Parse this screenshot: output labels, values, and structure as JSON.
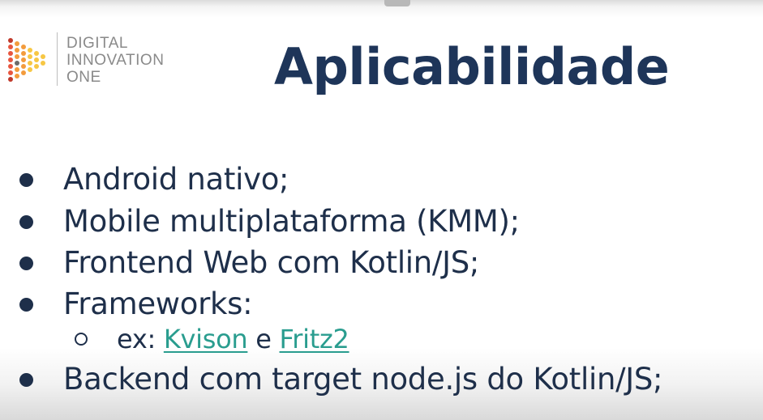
{
  "logo": {
    "line1": "DIGITAL",
    "line2": "INNOVATION",
    "line3": "ONE",
    "colors": [
      "#f7c744",
      "#f39c3d",
      "#e8563f",
      "#c0392b",
      "#6b6b6b"
    ]
  },
  "title": "Aplicabilidade",
  "bullets": [
    "Android nativo;",
    "Mobile multiplataforma (KMM);",
    "Frontend Web com Kotlin/JS;",
    "Frameworks:",
    "Backend com target node.js do Kotlin/JS;"
  ],
  "sub_bullet": {
    "prefix": "ex:",
    "link1": "Kvison",
    "conjunction": "e",
    "link2": "Fritz2"
  },
  "colors": {
    "title": "#1e3559",
    "text": "#1e2f4a",
    "link": "#2a9d8f"
  }
}
